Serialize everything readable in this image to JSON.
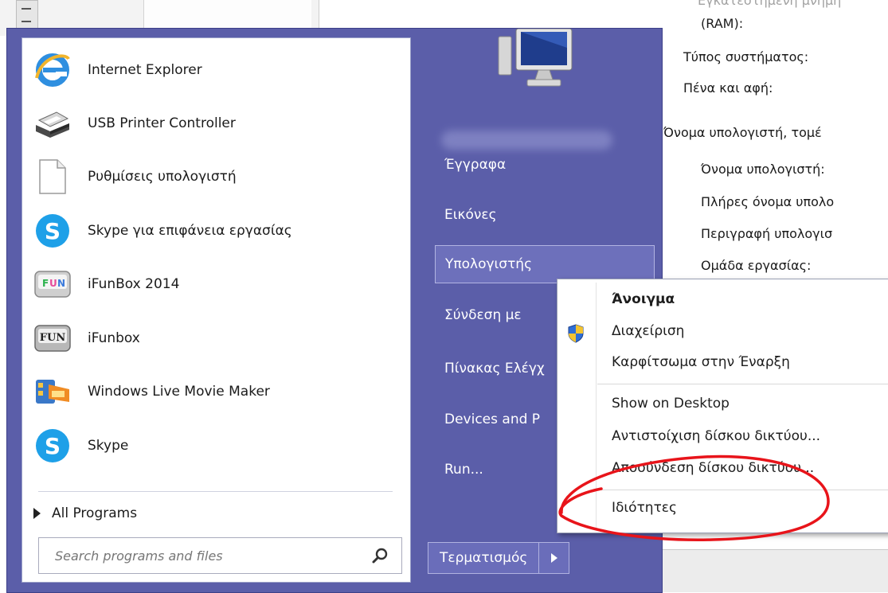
{
  "background": {
    "texts": [
      {
        "key": "ram",
        "text": "(RAM):"
      },
      {
        "key": "system_type",
        "text": "Τύπος συστήματος:"
      },
      {
        "key": "pen_touch",
        "text": "Πένα και αφή:"
      },
      {
        "key": "section",
        "text": "Όνομα υπολογιστή, τομέ"
      },
      {
        "key": "computer_name",
        "text": "Όνομα υπολογιστή:"
      },
      {
        "key": "full_name",
        "text": "Πλήρες όνομα υπολο"
      },
      {
        "key": "description",
        "text": "Περιγραφή υπολογισ"
      },
      {
        "key": "workgroup",
        "text": "Ομάδα εργασίας:"
      }
    ],
    "cut_text": "Εγκατεστημένη μνήμη"
  },
  "start_menu": {
    "programs": [
      {
        "label": "Internet Explorer",
        "icon": "internet-explorer-icon"
      },
      {
        "label": "USB Printer Controller",
        "icon": "printer-icon"
      },
      {
        "label": "Ρυθμίσεις υπολογιστή",
        "icon": "document-icon"
      },
      {
        "label": "Skype για επιφάνεια εργασίας",
        "icon": "skype-icon"
      },
      {
        "label": "iFunBox 2014",
        "icon": "ifunbox-2014-icon"
      },
      {
        "label": "iFunbox",
        "icon": "ifunbox-icon"
      },
      {
        "label": "Windows Live Movie Maker",
        "icon": "movie-maker-icon"
      },
      {
        "label": "Skype",
        "icon": "skype-icon"
      }
    ],
    "all_programs": "All Programs",
    "search_placeholder": "Search programs and files",
    "right_items": [
      {
        "label": "Έγγραφα",
        "selected": false
      },
      {
        "label": "Εικόνες",
        "selected": false
      },
      {
        "label": "Υπολογιστής",
        "selected": true
      },
      {
        "label": "Σύνδεση με",
        "selected": false
      },
      {
        "label": "Πίνακας Ελέγχ",
        "selected": false
      },
      {
        "label": "Devices and P",
        "selected": false
      },
      {
        "label": "Run...",
        "selected": false
      }
    ],
    "shutdown_label": "Τερματισμός"
  },
  "context_menu": {
    "items": [
      {
        "label": "Άνοιγμα",
        "bold": true
      },
      {
        "label": "Διαχείριση",
        "icon": "uac-shield-icon"
      },
      {
        "label": "Καρφίτσωμα στην Έναρξη"
      },
      {
        "label": "Show on Desktop"
      },
      {
        "label": "Αντιστοίχιση δίσκου δικτύου..."
      },
      {
        "label": "Αποσύνδεση δίσκου δικτύου..."
      },
      {
        "label": "Ιδιότητες"
      }
    ]
  },
  "colors": {
    "start_menu_bg": "#5b5ea9",
    "annotation": "#e8141a"
  }
}
